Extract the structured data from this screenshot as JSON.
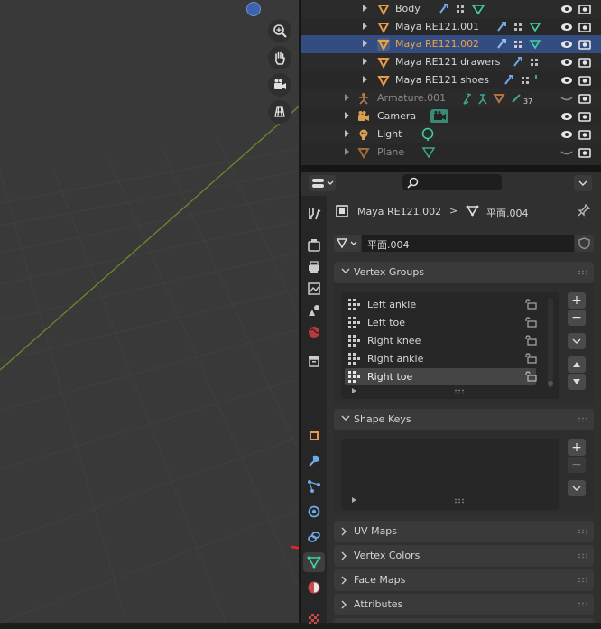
{
  "outliner": {
    "rows": [
      {
        "label": "Body",
        "color": "#d8d8d8"
      },
      {
        "label": "Maya RE121.001",
        "color": "#d8d8d8"
      },
      {
        "label": "Maya RE121.002",
        "color": "#f0a040"
      },
      {
        "label": "Maya RE121 drawers",
        "color": "#d8d8d8"
      },
      {
        "label": "Maya RE121 shoes",
        "color": "#d8d8d8"
      },
      {
        "label": "Armature.001",
        "color": "#8a8a8a",
        "badge": "37"
      },
      {
        "label": "Camera",
        "color": "#d8d8d8"
      },
      {
        "label": "Light",
        "color": "#d8d8d8"
      },
      {
        "label": "Plane",
        "color": "#8a8a8a"
      }
    ]
  },
  "properties": {
    "breadcrumb_object": "Maya RE121.002",
    "breadcrumb_sep": ">",
    "breadcrumb_data": "平面.004",
    "mesh_name": "平面.004",
    "vertex_groups": {
      "title": "Vertex Groups",
      "items": [
        "Left ankle",
        "Left toe",
        "Right knee",
        "Right ankle",
        "Right toe"
      ]
    },
    "shape_keys": {
      "title": "Shape Keys"
    },
    "collapsed_panels": [
      "UV Maps",
      "Vertex Colors",
      "Face Maps",
      "Attributes"
    ]
  },
  "colors": {
    "accent_orange": "#f0a040",
    "selection": "#334d80",
    "mesh_green": "#3fd4a0"
  }
}
